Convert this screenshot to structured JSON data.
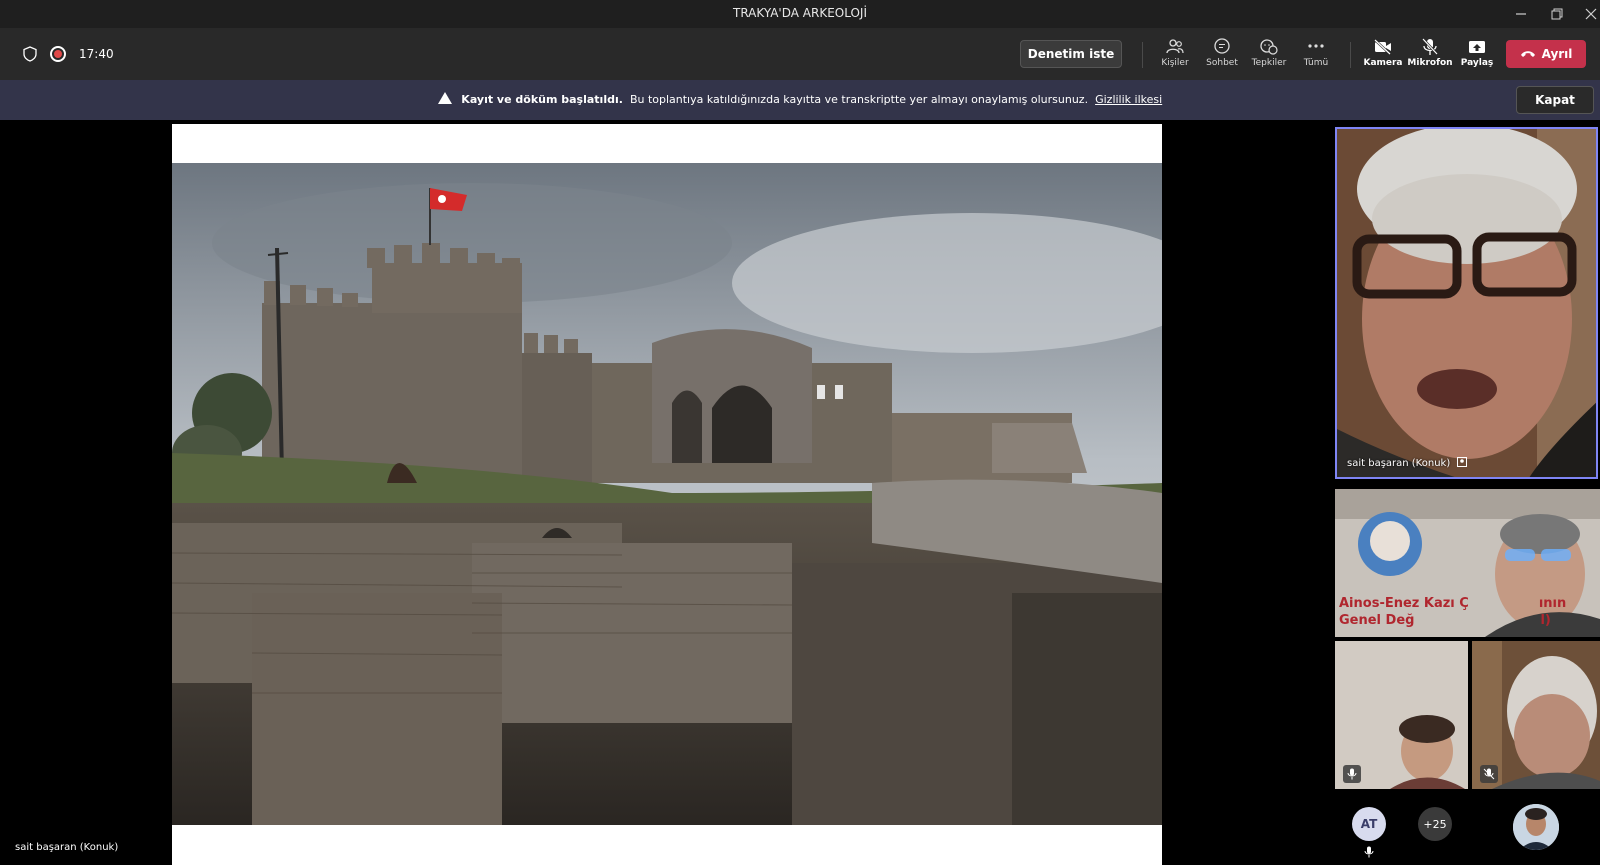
{
  "window": {
    "title": "TRAKYA'DA ARKEOLOJİ",
    "controls": [
      "minimize-icon",
      "restore-icon",
      "close-icon"
    ]
  },
  "toolbar": {
    "time": "17:40",
    "request_control_label": "Denetim iste",
    "items": [
      {
        "label": "Kişiler",
        "icon": "people-icon"
      },
      {
        "label": "Sohbet",
        "icon": "chat-icon"
      },
      {
        "label": "Tepkiler",
        "icon": "reactions-icon"
      },
      {
        "label": "Tümü",
        "icon": "more-icon"
      },
      {
        "label": "Kamera",
        "icon": "camera-off-icon"
      },
      {
        "label": "Mikrofon",
        "icon": "mic-off-icon"
      },
      {
        "label": "Paylaş",
        "icon": "share-icon"
      }
    ],
    "leave_label": "Ayrıl",
    "accent_leave": "#c4314b"
  },
  "banner": {
    "bold": "Kayıt ve döküm başlatıldı.",
    "text": "Bu toplantıya katıldığınızda kayıtta ve transkriptte yer almayı onaylamış olursunuz.",
    "link": "Gizlilik ilkesi",
    "close_label": "Kapat"
  },
  "stage": {
    "presenter_label": "sait başaran (Konuk)"
  },
  "participants": {
    "active_speaker": "sait başaran (Konuk)",
    "shared_title_line1": "Ainos-Enez Kazı Ç",
    "shared_title_line1b": "ının",
    "shared_title_line2": "Genel Değ",
    "shared_title_line2b": "l)",
    "avatar_initials": "AT",
    "overflow_count": "+25"
  }
}
